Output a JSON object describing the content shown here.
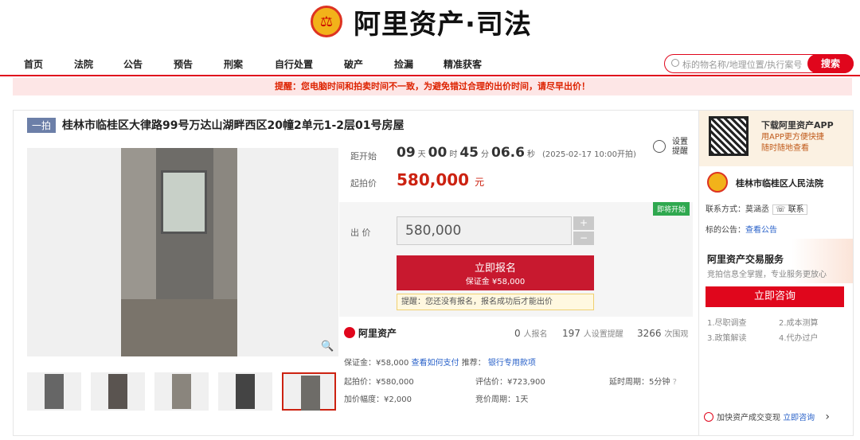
{
  "header": {
    "brand": "阿里资产·司法"
  },
  "nav": {
    "items": [
      "首页",
      "法院",
      "公告",
      "预告",
      "刑案",
      "自行处置",
      "破产",
      "捡漏",
      "精准获客"
    ],
    "search_placeholder": "标的物名称/地理位置/执行案号",
    "search_button": "搜索"
  },
  "warning": "提醒：您电脑时间和拍卖时间不一致，为避免错过合理的出价时间，请尽早出价！",
  "item": {
    "tag": "一拍",
    "title": "桂林市临桂区大律路99号万达山湖畔西区20幢2单元1-2层01号房屋"
  },
  "auction": {
    "countdown_label": "距开始",
    "days": "09",
    "days_unit": "天",
    "hours": "00",
    "hours_unit": "时",
    "minutes": "45",
    "minutes_unit": "分",
    "seconds": "06.6",
    "seconds_unit": "秒",
    "start_time": "(2025-02-17 10:00开拍)",
    "alarm_label": "设置\n提醒",
    "start_price_label": "起拍价",
    "start_price": "580,000",
    "currency_unit": "元",
    "status_badge": "即将开始",
    "bid_label": "出 价",
    "bid_value": "580,000",
    "plus": "+",
    "minus": "−",
    "signup_label": "立即报名",
    "deposit_line": "保证金 ¥58,000",
    "tip": "提醒：您还没有报名，报名成功后才能出价"
  },
  "stats": {
    "platform": "阿里资产",
    "signups": "0",
    "signups_label": "人报名",
    "reminders": "197",
    "reminders_label": "人设置提醒",
    "views": "3266",
    "views_label": "次围观"
  },
  "details": {
    "deposit": "保证金：¥58,000",
    "deposit_link": "查看如何支付",
    "recommend": "推荐：",
    "recommend_link": "银行专用款项",
    "start_price": "起拍价：¥580,000",
    "appraisal": "评估价：¥723,900",
    "delay": "延时周期：5分钟",
    "increment": "加价幅度：¥2,000",
    "cycle": "竞价周期：1天"
  },
  "sidebar": {
    "app_title": "下载阿里资产APP",
    "app_desc1": "用APP更方便快捷",
    "app_desc2": "随时随地查看",
    "court": "桂林市临桂区人民法院",
    "contact": "联系方式：莫涵丞",
    "contact_btn": "联系",
    "notice": "标的公告：",
    "notice_link": "查看公告",
    "service_title": "阿里资产交易服务",
    "service_desc": "竞拍信息全掌握，专业服务更放心",
    "consult_btn": "立即咨询",
    "services": [
      "1.尽职调查",
      "2.成本测算",
      "3.政策解读",
      "4.代办过户"
    ],
    "footer": "加快资产成交变现",
    "footer_link": "立即咨询",
    "footer_arrow": "›"
  },
  "colors": {
    "accent": "#e0061c",
    "price": "#c21",
    "badge": "#2fa84f",
    "link": "#2a62c9"
  }
}
